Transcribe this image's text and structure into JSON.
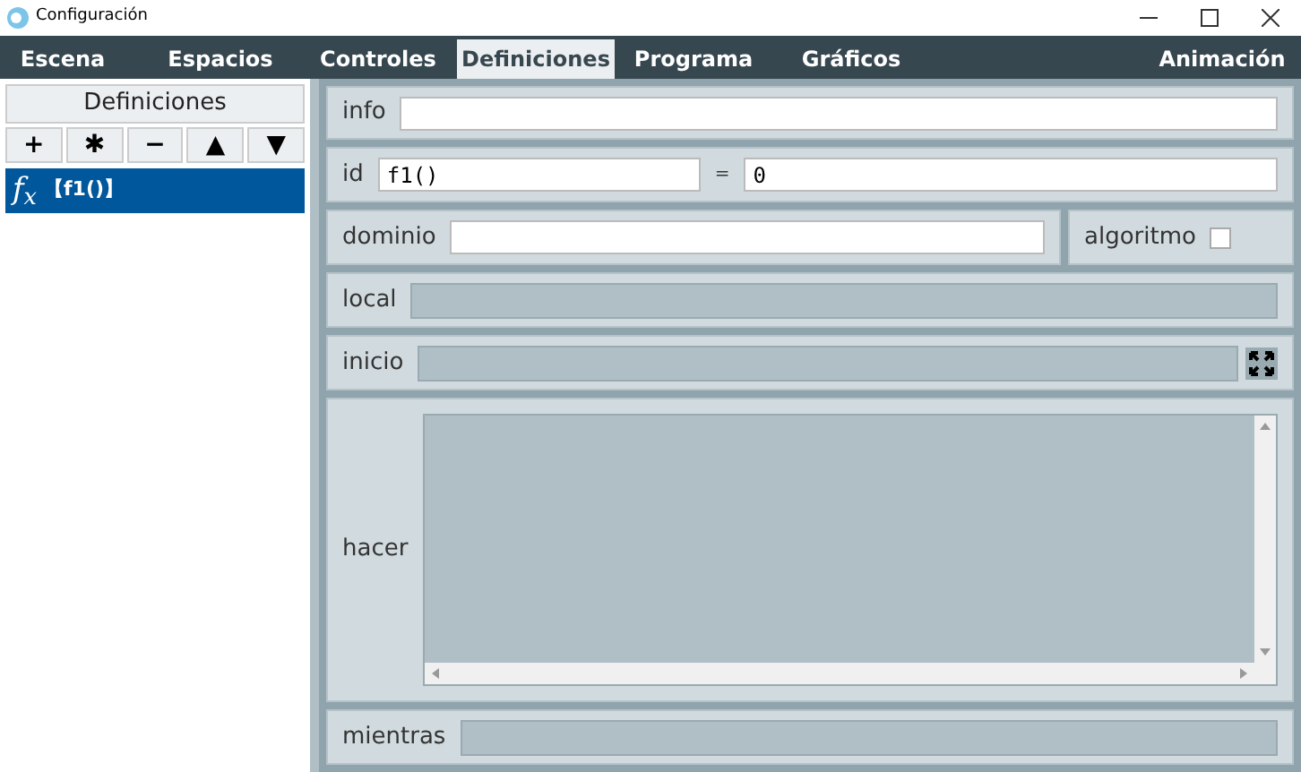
{
  "window": {
    "title": "Configuración"
  },
  "tabs": [
    {
      "label": "Escena",
      "selected": false
    },
    {
      "label": "Espacios",
      "selected": false
    },
    {
      "label": "Controles",
      "selected": false
    },
    {
      "label": "Definiciones",
      "selected": true
    },
    {
      "label": "Programa",
      "selected": false
    },
    {
      "label": "Gráficos",
      "selected": false
    }
  ],
  "tabs_right": [
    {
      "label": "Animación",
      "selected": false
    }
  ],
  "sidebar": {
    "title": "Definiciones",
    "buttons": [
      "+",
      "✱",
      "−",
      "▲",
      "▼"
    ],
    "items": [
      {
        "symbol": "f$_{x}$",
        "label": "【f1()】",
        "selected": true
      }
    ]
  },
  "form": {
    "info": {
      "label": "info"
    },
    "id": {
      "label": "id",
      "value": "f1()",
      "equals": "=",
      "expression": "0"
    },
    "dominio": {
      "label": "dominio"
    },
    "algoritmo": {
      "label": "algoritmo",
      "checked": false
    },
    "code_rows": [
      {
        "label": "local",
        "kind": "line"
      },
      {
        "label": "inicio",
        "kind": "expandable"
      },
      {
        "label": "hacer",
        "kind": "area"
      },
      {
        "label": "mientras",
        "kind": "line"
      }
    ]
  }
}
